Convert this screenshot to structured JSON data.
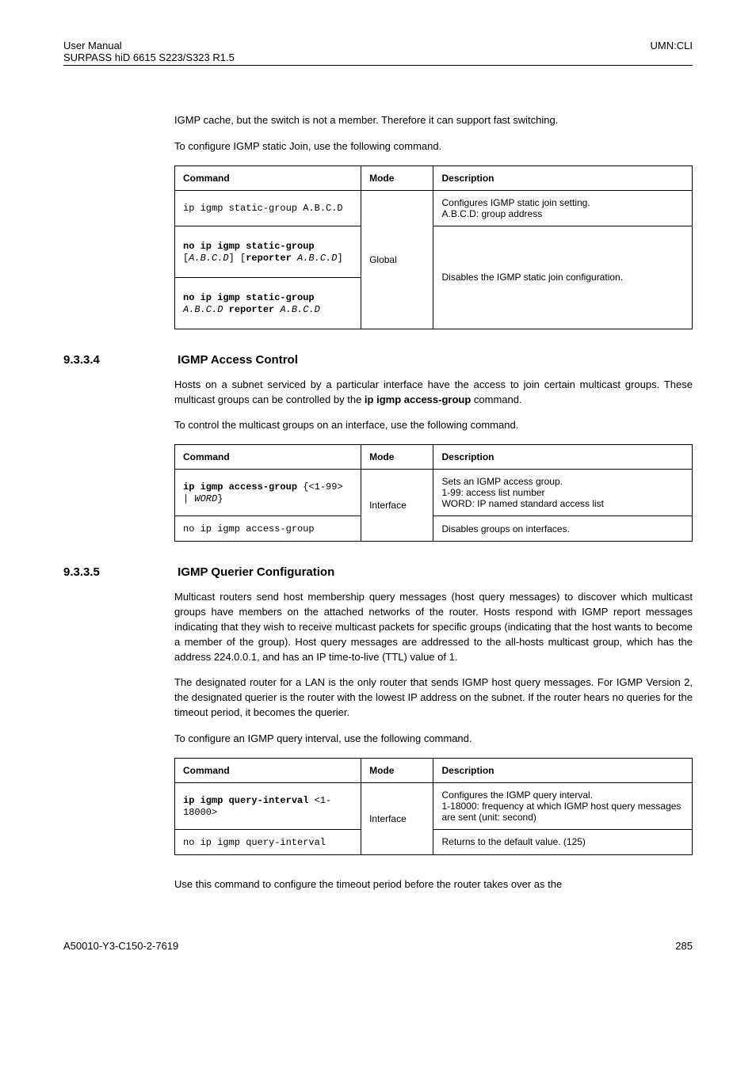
{
  "header": {
    "left1": "User Manual",
    "left2": "SURPASS hiD 6615 S223/S323 R1.5",
    "right": "UMN:CLI"
  },
  "intro": {
    "p1": "IGMP cache, but the switch is not a member. Therefore it can support fast switching.",
    "p2": "To configure IGMP static Join, use the following command."
  },
  "table1": {
    "h1": "Command",
    "h2": "Mode",
    "h3": "Description",
    "r1c1": "ip igmp static-group A.B.C.D",
    "r1c3": "Configures IGMP static join setting.\nA.B.C.D: group address",
    "r2c1": "no ip igmp static-group [A.B.C.D] [reporter A.B.C.D]",
    "mode": "Global",
    "r2c3": "Disables the IGMP static join configuration.",
    "r3c1": "no ip igmp static-group A.B.C.D reporter A.B.C.D"
  },
  "sec2": {
    "num": "9.3.3.4",
    "title": "IGMP Access Control",
    "p1a": "Hosts on a subnet serviced by a particular interface have the access to join certain multicast groups. These multicast groups can be controlled by the ",
    "p1b": "ip igmp access-group",
    "p1c": " command.",
    "p2": "To control the multicast groups on an interface, use the following command."
  },
  "table2": {
    "h1": "Command",
    "h2": "Mode",
    "h3": "Description",
    "r1c1": "ip igmp access-group {<1-99> | WORD}",
    "mode": "Interface",
    "r1c3": "Sets an IGMP access group.\n1-99: access list number\nWORD: IP named standard access list",
    "r2c1": "no ip igmp access-group",
    "r2c3": "Disables groups on interfaces."
  },
  "sec3": {
    "num": "9.3.3.5",
    "title": "IGMP Querier Configuration",
    "p1": "Multicast routers send host membership query messages (host query messages) to discover which multicast groups have members on the attached networks of the router. Hosts respond with IGMP report messages indicating that they wish to receive multicast packets for specific groups (indicating that the host wants to become a member of the group). Host query messages are addressed to the all-hosts multicast group, which has the address 224.0.0.1, and has an IP time-to-live (TTL) value of 1.",
    "p2": "The designated router for a LAN is the only router that sends IGMP host query messages. For IGMP Version 2, the designated querier is the router with the lowest IP address on the subnet. If the router hears no queries for the timeout period, it becomes the querier.",
    "p3": "To configure an IGMP query interval, use the following command."
  },
  "table3": {
    "h1": "Command",
    "h2": "Mode",
    "h3": "Description",
    "r1c1": "ip igmp query-interval <1-18000>",
    "mode": "Interface",
    "r1c3": "Configures the IGMP query interval.\n1-18000: frequency at which IGMP host query messages are sent (unit: second)",
    "r2c1": "no ip igmp query-interval",
    "r2c3": "Returns to the default value. (125)"
  },
  "outro": {
    "p1": "Use this command to configure the timeout period before the router takes over as the"
  },
  "footer": {
    "left": "A50010-Y3-C150-2-7619",
    "right": "285"
  }
}
